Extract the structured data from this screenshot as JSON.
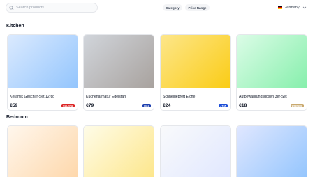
{
  "search": {
    "placeholder": "Search products..."
  },
  "filters": {
    "category": "Category",
    "price_range": "Price Range"
  },
  "country": {
    "label": "Germany",
    "flag_colors": [
      "#111111",
      "#dd0000",
      "#ffce00"
    ]
  },
  "sections": [
    {
      "title": "Kitchen",
      "products": [
        {
          "name": "Keramik Geschirr-Set 12-tlg",
          "price": "€59",
          "store": "GALERIA",
          "badge_color": "#dc2626",
          "image_from": "#dbeafe",
          "image_to": "#93c5fd"
        },
        {
          "name": "Küchenarmatur Edelstahl",
          "price": "€79",
          "store": "IKEA",
          "badge_color": "#1e40af",
          "image_from": "#d1d5db",
          "image_to": "#a8a29e"
        },
        {
          "name": "Schneidebrett Eiche",
          "price": "€24",
          "store": "JYSK",
          "badge_color": "#1d4ed8",
          "image_from": "#fde68a",
          "image_to": "#facc15"
        },
        {
          "name": "Aufbewahrungsdosen 3er-Set",
          "price": "€18",
          "store": "Westwing",
          "badge_color": "#c9a96e",
          "image_from": "#dcfce7",
          "image_to": "#86efac"
        }
      ]
    },
    {
      "title": "Bedroom",
      "products": [
        {
          "image_from": "#fff7ed",
          "image_to": "#fed7aa"
        },
        {
          "image_from": "#fefce8",
          "image_to": "#fde68a"
        },
        {
          "image_from": "#f9fafb",
          "image_to": "#e0e7ff"
        },
        {
          "image_from": "#e0e7ff",
          "image_to": "#93c5fd"
        }
      ]
    }
  ]
}
